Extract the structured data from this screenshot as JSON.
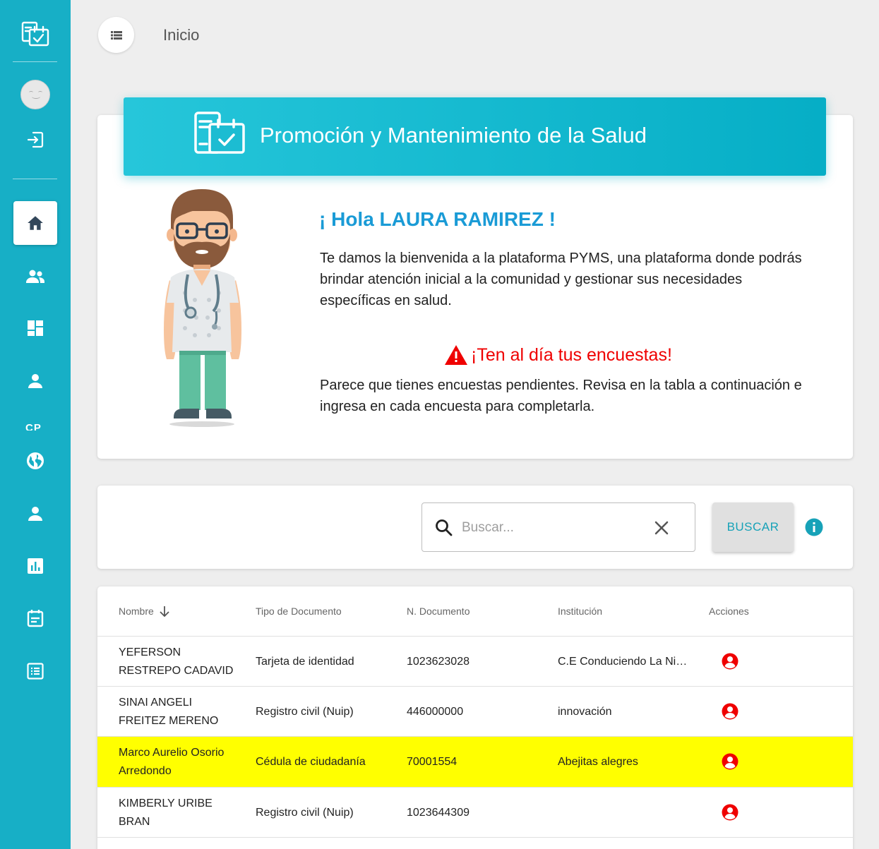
{
  "page": {
    "title": "Inicio"
  },
  "sidebar": {
    "cp_label": "CP",
    "items": [
      "logo-icon",
      "avatar",
      "login-icon",
      "home-icon",
      "people-icon",
      "dashboard-icon",
      "person-icon",
      "globe-icon",
      "person-icon",
      "bar-chart-icon",
      "calendar-icon",
      "list-icon"
    ]
  },
  "banner": {
    "title": "Promoción y Mantenimiento de la Salud"
  },
  "welcome": {
    "greeting": "¡ Hola LAURA RAMIREZ !",
    "intro": "Te damos la bienvenida a la plataforma PYMS, una plataforma donde podrás brindar atención inicial a la comunidad y gestionar sus necesidades específicas en salud.",
    "alert_title": "¡Ten al día tus encuestas!",
    "alert_text": "Parece que tienes encuestas pendientes. Revisa en la tabla a continuación e ingresa en cada encuesta para completarla."
  },
  "search": {
    "placeholder": "Buscar...",
    "button": "BUSCAR"
  },
  "table": {
    "headers": {
      "name": "Nombre",
      "doc_type": "Tipo de Documento",
      "doc_num": "N. Documento",
      "institution": "Institución",
      "actions": "Acciones"
    },
    "rows": [
      {
        "name_1": "YEFERSON",
        "name_2": "RESTREPO CADAVID",
        "doc_type": "Tarjeta de identidad",
        "doc_num": "1023623028",
        "institution": "C.E Conduciendo La Ni…"
      },
      {
        "name_1": "SINAI ANGELI",
        "name_2": "FREITEZ MERENO",
        "doc_type": "Registro civil (Nuip)",
        "doc_num": "446000000",
        "institution": "innovación"
      },
      {
        "name_1": "Marco Aurelio Osorio",
        "name_2": "Arredondo",
        "doc_type": "Cédula de ciudadanía",
        "doc_num": "70001554",
        "institution": "Abejitas alegres"
      },
      {
        "name_1": "KIMBERLY URIBE",
        "name_2": "BRAN",
        "doc_type": "Registro civil (Nuip)",
        "doc_num": "1023644309",
        "institution": ""
      }
    ]
  },
  "colors": {
    "sidebar": "#17afc6",
    "greeting": "#1a9bd6",
    "alert": "#ef0000",
    "highlight_row": "#ffff00"
  }
}
